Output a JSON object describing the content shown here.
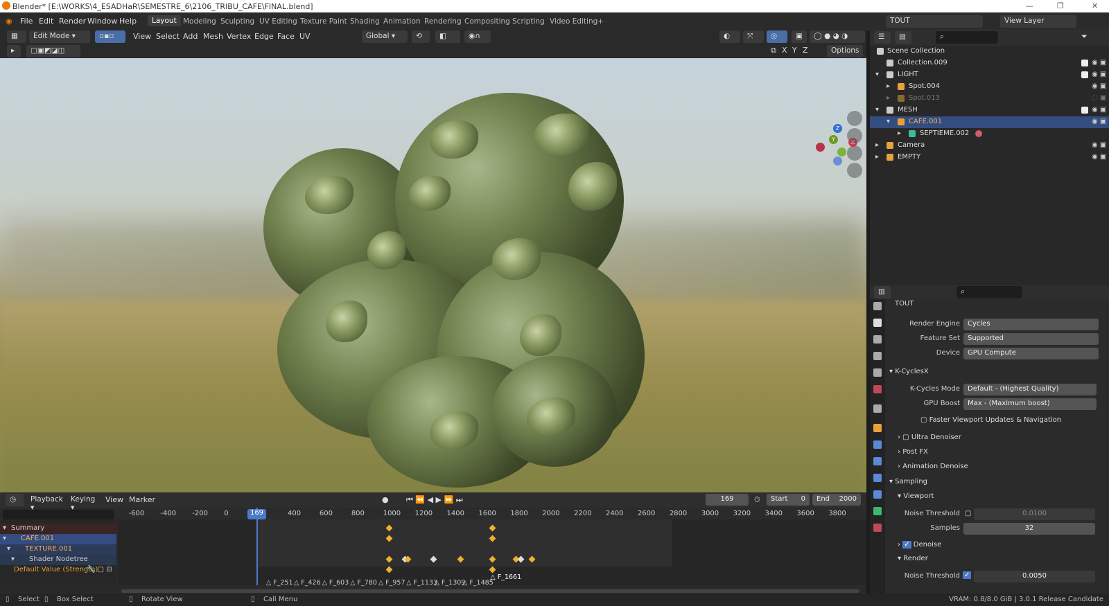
{
  "window_title": "Blender* [E:\\WORKS\\4_ESADHaR\\SEMESTRE_6\\2106_TRIBU_CAFE\\FINAL.blend]",
  "menus": [
    "File",
    "Edit",
    "Render",
    "Window",
    "Help"
  ],
  "workspaces": [
    "Layout",
    "Modeling",
    "Sculpting",
    "UV Editing",
    "Texture Paint",
    "Shading",
    "Animation",
    "Rendering",
    "Compositing",
    "Scripting",
    "Video Editing",
    "+"
  ],
  "scene_name": "TOUT",
  "view_layer": "View Layer",
  "viewport_header": {
    "mode": "Edit Mode",
    "menus": [
      "View",
      "Select",
      "Add",
      "Mesh",
      "Vertex",
      "Edge",
      "Face",
      "UV"
    ],
    "transform": "Global",
    "options": "Options",
    "axes": [
      "X",
      "Y",
      "Z"
    ]
  },
  "gizmo": {
    "z": "Z",
    "y": "Y",
    "x": "X"
  },
  "outliner": {
    "rows": [
      {
        "label": "Scene Collection",
        "indent": 0
      },
      {
        "label": "Collection.009",
        "indent": 1
      },
      {
        "label": "LIGHT",
        "indent": 1
      },
      {
        "label": "Spot.004",
        "indent": 2
      },
      {
        "label": "Spot.013",
        "indent": 2
      },
      {
        "label": "MESH",
        "indent": 1
      },
      {
        "label": "CAFE.001",
        "indent": 2
      },
      {
        "label": "SEPTIEME.002",
        "indent": 3
      },
      {
        "label": "Camera",
        "indent": 1
      },
      {
        "label": "EMPTY",
        "indent": 1
      }
    ]
  },
  "properties": {
    "title": "TOUT",
    "render_engine_label": "Render Engine",
    "render_engine": "Cycles",
    "feature_set_label": "Feature Set",
    "feature_set": "Supported",
    "device_label": "Device",
    "device": "GPU Compute",
    "kcycles_section": "K-CyclesX",
    "kcycles_mode_label": "K-Cycles Mode",
    "kcycles_mode": "Default - (Highest Quality)",
    "gpu_boost_label": "GPU Boost",
    "gpu_boost": "Max - (Maximum boost)",
    "faster_viewport": "Faster Viewport Updates & Navigation",
    "ultra_denoiser": "Ultra Denoiser",
    "post_fx": "Post FX",
    "animation_denoise": "Animation Denoise",
    "sampling": "Sampling",
    "viewport": "Viewport",
    "noise_threshold_label": "Noise Threshold",
    "viewport_noise_threshold": "0.0100",
    "samples_label": "Samples",
    "viewport_samples": "32",
    "denoise": "Denoise",
    "render": "Render",
    "render_noise_threshold": "0.0050"
  },
  "timeline": {
    "menus": [
      "Playback",
      "Keying",
      "View",
      "Marker"
    ],
    "current_frame": "169",
    "start_label": "Start",
    "start": "0",
    "end_label": "End",
    "end": "2000",
    "ruler": [
      "-600",
      "-400",
      "-200",
      "0",
      "169",
      "400",
      "600",
      "800",
      "1000",
      "1200",
      "1400",
      "1600",
      "1800",
      "2000",
      "2200",
      "2400",
      "2600",
      "2800",
      "3000",
      "3200",
      "3400",
      "3600",
      "3800"
    ],
    "channels": [
      "Summary",
      "CAFE.001",
      "TEXTURE.001",
      "Shader Nodetree",
      "Default Value (Strength)"
    ],
    "markers": [
      "F_251",
      "F_426",
      "F_603",
      "F_780",
      "F_957",
      "F_1133",
      "F_1309",
      "F_1485",
      "F_1661"
    ]
  },
  "status": {
    "select": "Select",
    "box_select": "Box Select",
    "rotate_view": "Rotate View",
    "call_menu": "Call Menu",
    "info": "VRAM: 0.8/8.0 GiB | 3.0.1 Release Candidate"
  }
}
